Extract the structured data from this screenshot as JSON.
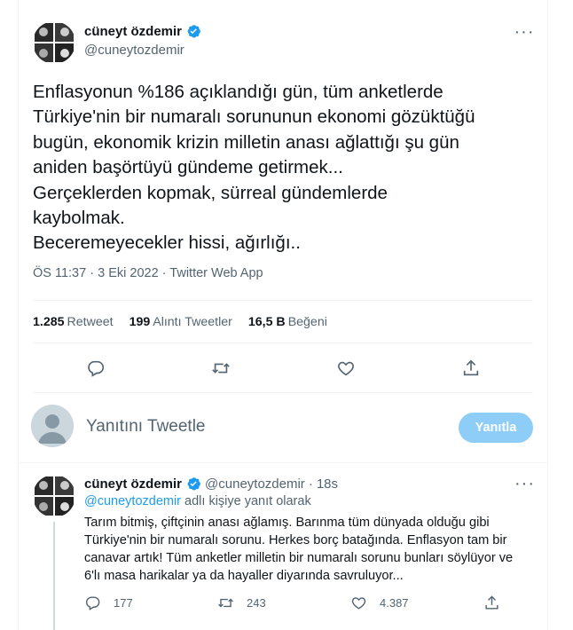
{
  "main_tweet": {
    "author_name": "cüneyt özdemir",
    "author_handle": "@cuneytozdemir",
    "text": "Enflasyonun %186 açıklandığı gün, tüm anketlerde\nTürkiye'nin bir numaralı sorununun ekonomi gözüktüğü\nbugün, ekonomik krizin milletin anası ağlattığı şu gün\naniden başörtüyü gündeme getirmek...\nGerçeklerden kopmak, sürreal gündemlerde\nkaybolmak.\nBeceremeyecekler hissi, ağırlığı..",
    "time": "ÖS 11:37",
    "date": "3 Eki 2022",
    "source": "Twitter Web App",
    "separator": "·",
    "stats": {
      "retweets_count": "1.285",
      "retweets_label": "Retweet",
      "quotes_count": "199",
      "quotes_label": "Alıntı Tweetler",
      "likes_count": "16,5 B",
      "likes_label": "Beğeni"
    },
    "more_glyph": "···"
  },
  "reply_composer": {
    "placeholder": "Yanıtını Tweetle",
    "button_label": "Yanıtla"
  },
  "reply_tweet": {
    "author_name": "cüneyt özdemir",
    "author_handle": "@cuneytozdemir",
    "dot": "·",
    "time_ago": "18s",
    "replying_to_handle": "@cuneytozdemir",
    "replying_to_suffix": "adlı kişiye yanıt olarak",
    "text": "Tarım bitmiş, çiftçinin anası ağlamış. Barınma tüm dünyada olduğu gibi\nTürkiye'nin bir numaralı sorunu. Herkes borç batağında. Enflasyon tam bir\ncanavar artık! Tüm anketler milletin bir numaralı sorunu bunları söylüyor ve\n6'lı masa harikalar ya da hayaller diyarında savruluyor...",
    "replies": "177",
    "retweets": "243",
    "likes": "4.387",
    "more_glyph": "···"
  },
  "colors": {
    "accent": "#1d9bf0",
    "muted": "#536471",
    "button_disabled": "#8ecdf8"
  },
  "icons": [
    "verified-badge-icon",
    "reply-icon",
    "retweet-icon",
    "like-icon",
    "share-icon",
    "more-icon"
  ]
}
